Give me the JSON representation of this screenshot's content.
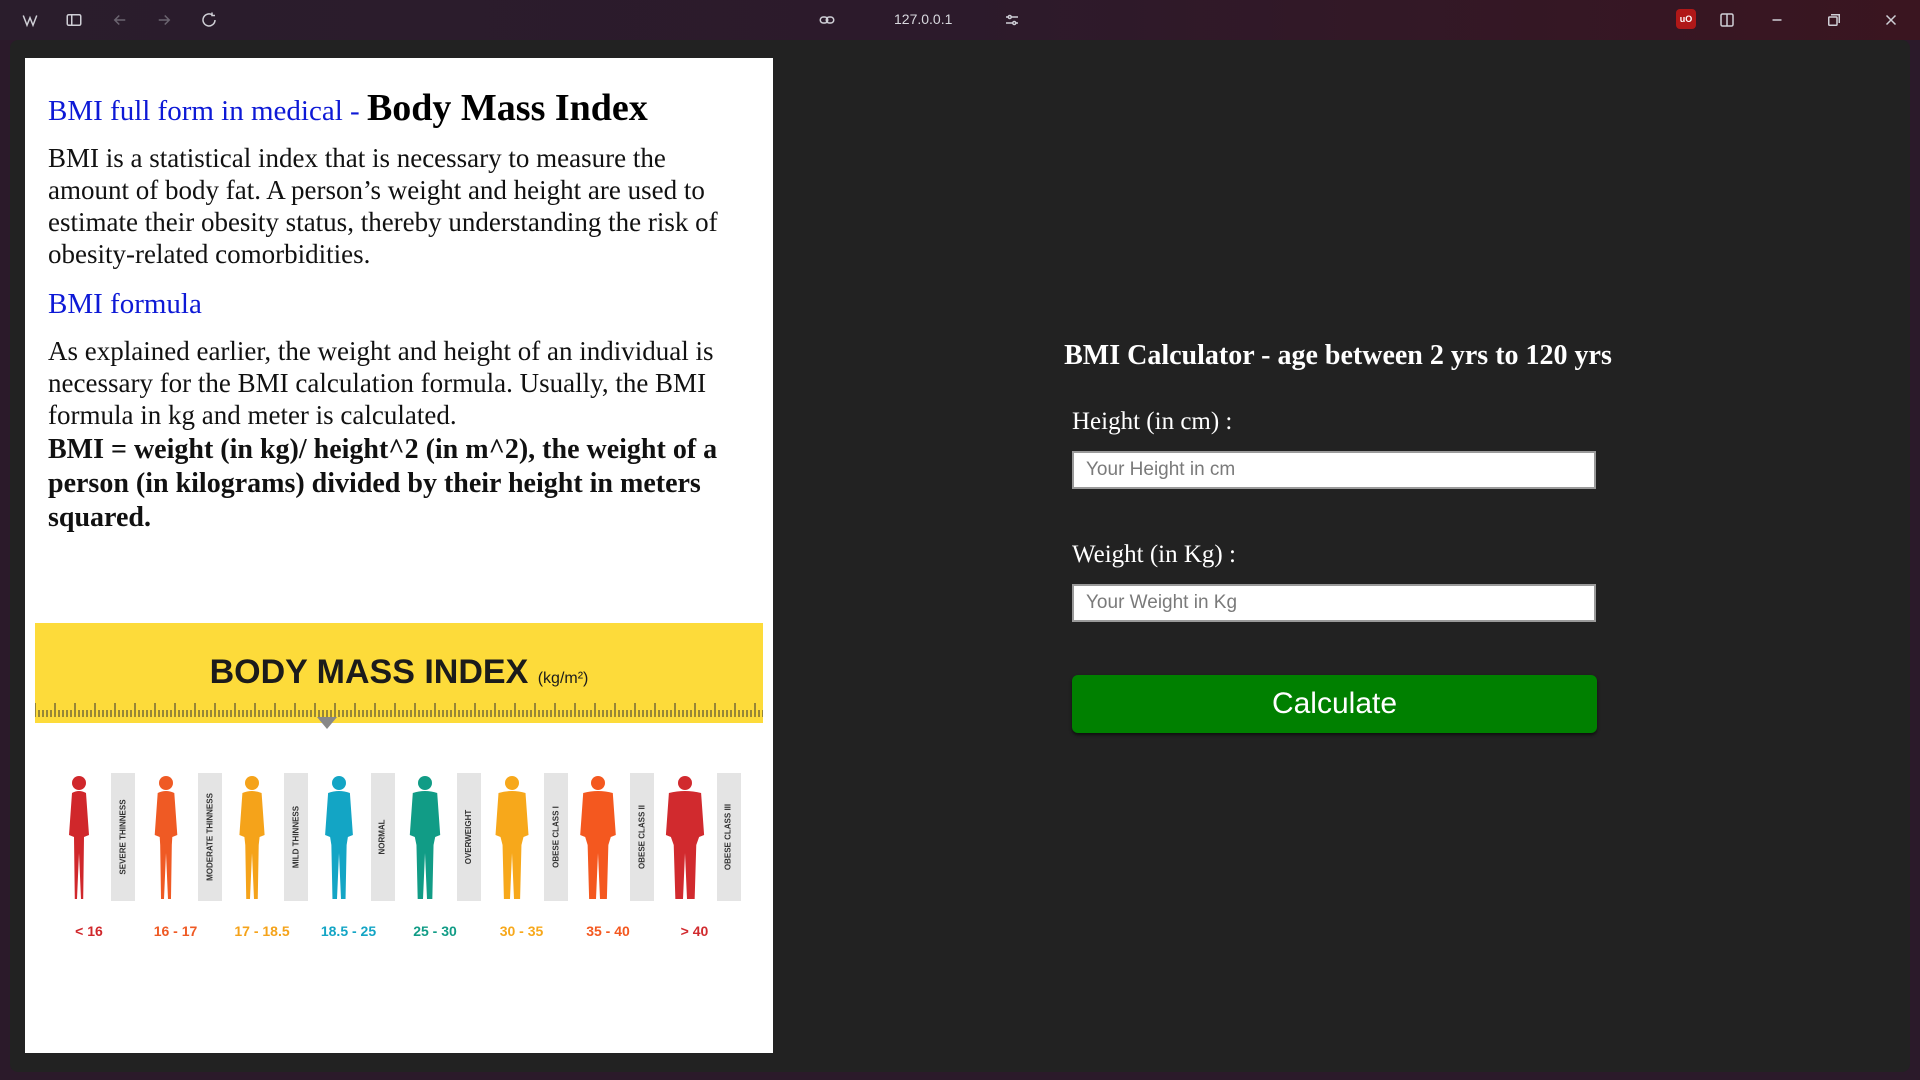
{
  "browser": {
    "url": "127.0.0.1",
    "ublock_badge": "uO"
  },
  "info": {
    "subheading": "BMI full form in medical - ",
    "title": "Body Mass Index",
    "intro": "BMI is a statistical index that is necessary to measure the amount of body fat. A person’s weight and height are used to estimate their obesity status, thereby understanding the risk of obesity-related comorbidities.",
    "formula_heading": "BMI formula",
    "formula_text": "As explained earlier, the weight and height of an individual is necessary for the BMI calculation formula. Usually, the BMI formula in kg and meter is calculated.",
    "formula_bold": "BMI = weight (in kg)/ height^2 (in m^2), the weight of a person (in kilograms) divided by their height in meters squared."
  },
  "infographic": {
    "title": "BODY MASS INDEX",
    "unit": "(kg/m²)",
    "categories": [
      {
        "label": "SEVERE THINNESS",
        "range": "< 16",
        "color": "#d0272b"
      },
      {
        "label": "MODERATE THINNESS",
        "range": "16 - 17",
        "color": "#ef5a24"
      },
      {
        "label": "MILD THINNESS",
        "range": "17 - 18.5",
        "color": "#f5a31a"
      },
      {
        "label": "NORMAL",
        "range": "18.5 - 25",
        "color": "#13a5c5"
      },
      {
        "label": "OVERWEIGHT",
        "range": "25 - 30",
        "color": "#119c86"
      },
      {
        "label": "OBESE CLASS I",
        "range": "30 - 35",
        "color": "#f7a81b"
      },
      {
        "label": "OBESE CLASS II",
        "range": "35 - 40",
        "color": "#f4581f"
      },
      {
        "label": "OBESE CLASS III",
        "range": "> 40",
        "color": "#d12a2e"
      }
    ]
  },
  "calculator": {
    "title": "BMI Calculator - age between 2 yrs to 120 yrs",
    "height_label": "Height (in cm) :",
    "height_placeholder": "Your Height in cm",
    "weight_label": "Weight (in Kg) :",
    "weight_placeholder": "Your Weight in Kg",
    "button_label": "Calculate"
  }
}
